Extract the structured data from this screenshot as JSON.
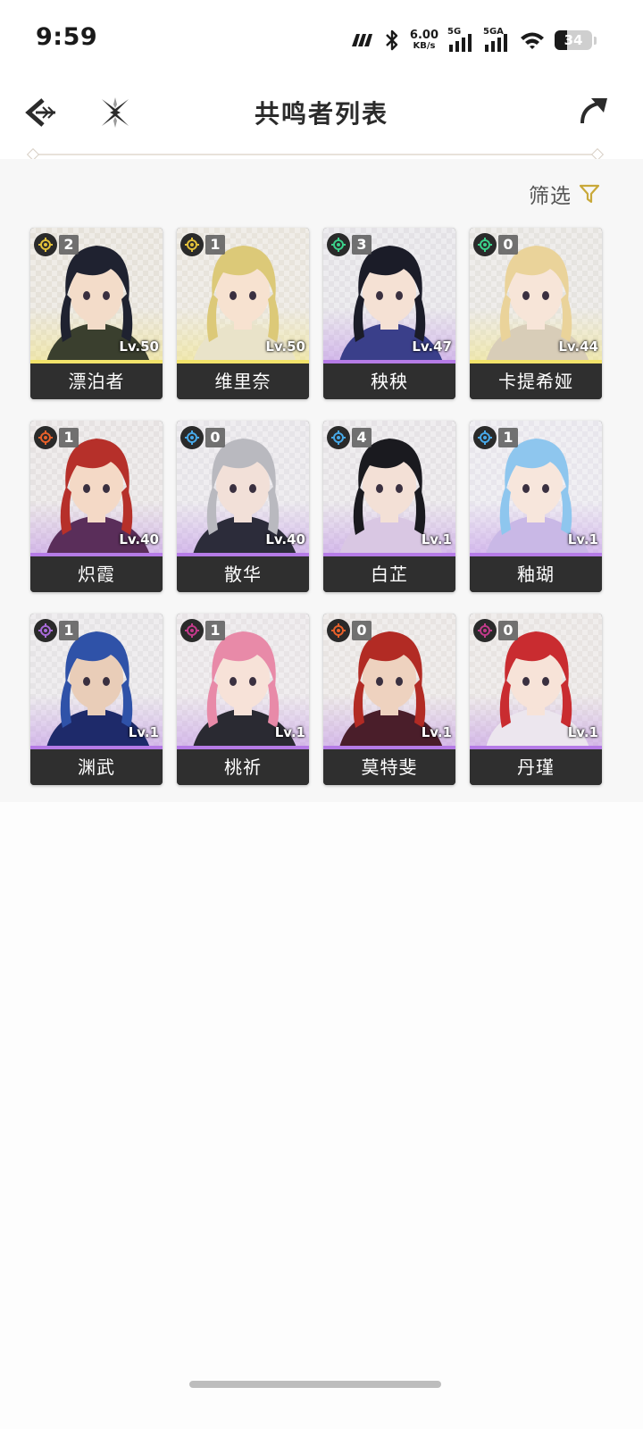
{
  "status_bar": {
    "time": "9:59",
    "net_speed_value": "6.00",
    "net_speed_unit": "KB/s",
    "signal1_label": "5G",
    "signal2_label": "5GA",
    "battery": "34",
    "battery_level": 0.34,
    "icons": [
      "carrier-icon",
      "bluetooth-icon",
      "signal-icon",
      "signal-icon",
      "wifi-icon",
      "battery-icon"
    ]
  },
  "header": {
    "title": "共鸣者列表",
    "icons": [
      "back-arrow-icon",
      "close-cross-icon",
      "share-arrow-icon"
    ]
  },
  "filter": {
    "label": "筛选",
    "icon": "filter-funnel-icon",
    "accent": "#c9a93a"
  },
  "element_colors": {
    "spectro": "#e3c13a",
    "aero": "#3bd18a",
    "fusion": "#e8602a",
    "glacio": "#47a8e8",
    "electro": "#a86ad8",
    "havoc": "#c23a8a"
  },
  "rarity_colors": {
    "5": "#f2e36a",
    "4": "#b57be6"
  },
  "characters": [
    {
      "name": "漂泊者",
      "level": "Lv.50",
      "sequence": "2",
      "element": "spectro",
      "rarity": "5",
      "hair": "#1f2230",
      "bg": "#e6e2da",
      "skin": "#f3dcc9",
      "outfit": "#3a3f2e"
    },
    {
      "name": "维里奈",
      "level": "Lv.50",
      "sequence": "1",
      "element": "spectro",
      "rarity": "5",
      "hair": "#dcc978",
      "bg": "#e8e4dc",
      "skin": "#f7e2d0",
      "outfit": "#e9e3c9"
    },
    {
      "name": "秧秧",
      "level": "Lv.47",
      "sequence": "3",
      "element": "aero",
      "rarity": "4",
      "hair": "#1b1c28",
      "bg": "#e4e2e6",
      "skin": "#f5e1d4",
      "outfit": "#3a3f8a"
    },
    {
      "name": "卡提希娅",
      "level": "Lv.44",
      "sequence": "0",
      "element": "aero",
      "rarity": "5",
      "hair": "#ead39a",
      "bg": "#e6e4e0",
      "skin": "#f7e5d8",
      "outfit": "#d8cdb8"
    },
    {
      "name": "炽霞",
      "level": "Lv.40",
      "sequence": "1",
      "element": "fusion",
      "rarity": "4",
      "hair": "#b6302a",
      "bg": "#e6e2e2",
      "skin": "#f4d9c6",
      "outfit": "#5a2e5a"
    },
    {
      "name": "散华",
      "level": "Lv.40",
      "sequence": "0",
      "element": "glacio",
      "rarity": "4",
      "hair": "#b9b9bf",
      "bg": "#e6e4e8",
      "skin": "#f2e0d8",
      "outfit": "#2c2c3a"
    },
    {
      "name": "白芷",
      "level": "Lv.1",
      "sequence": "4",
      "element": "glacio",
      "rarity": "4",
      "hair": "#1a1a1f",
      "bg": "#e6e3e6",
      "skin": "#f3e0d6",
      "outfit": "#d9c7e3"
    },
    {
      "name": "釉瑚",
      "level": "Lv.1",
      "sequence": "1",
      "element": "glacio",
      "rarity": "4",
      "hair": "#8ec6ee",
      "bg": "#e8e6ec",
      "skin": "#f7e6dc",
      "outfit": "#c9b8e6"
    },
    {
      "name": "渊武",
      "level": "Lv.1",
      "sequence": "1",
      "element": "electro",
      "rarity": "4",
      "hair": "#2f52a8",
      "bg": "#e6e4e6",
      "skin": "#e9cdb8",
      "outfit": "#1e2a6a"
    },
    {
      "name": "桃祈",
      "level": "Lv.1",
      "sequence": "1",
      "element": "havoc",
      "rarity": "4",
      "hair": "#e88aa8",
      "bg": "#e8e4e6",
      "skin": "#f7e2d8",
      "outfit": "#2a2a32"
    },
    {
      "name": "莫特斐",
      "level": "Lv.1",
      "sequence": "0",
      "element": "fusion",
      "rarity": "4",
      "hair": "#b22b24",
      "bg": "#e8e4e2",
      "skin": "#eed2bf",
      "outfit": "#4a1e2a"
    },
    {
      "name": "丹瑾",
      "level": "Lv.1",
      "sequence": "0",
      "element": "havoc",
      "rarity": "4",
      "hair": "#c92c30",
      "bg": "#e8e4e2",
      "skin": "#f7e3d8",
      "outfit": "#ece6ee"
    }
  ]
}
